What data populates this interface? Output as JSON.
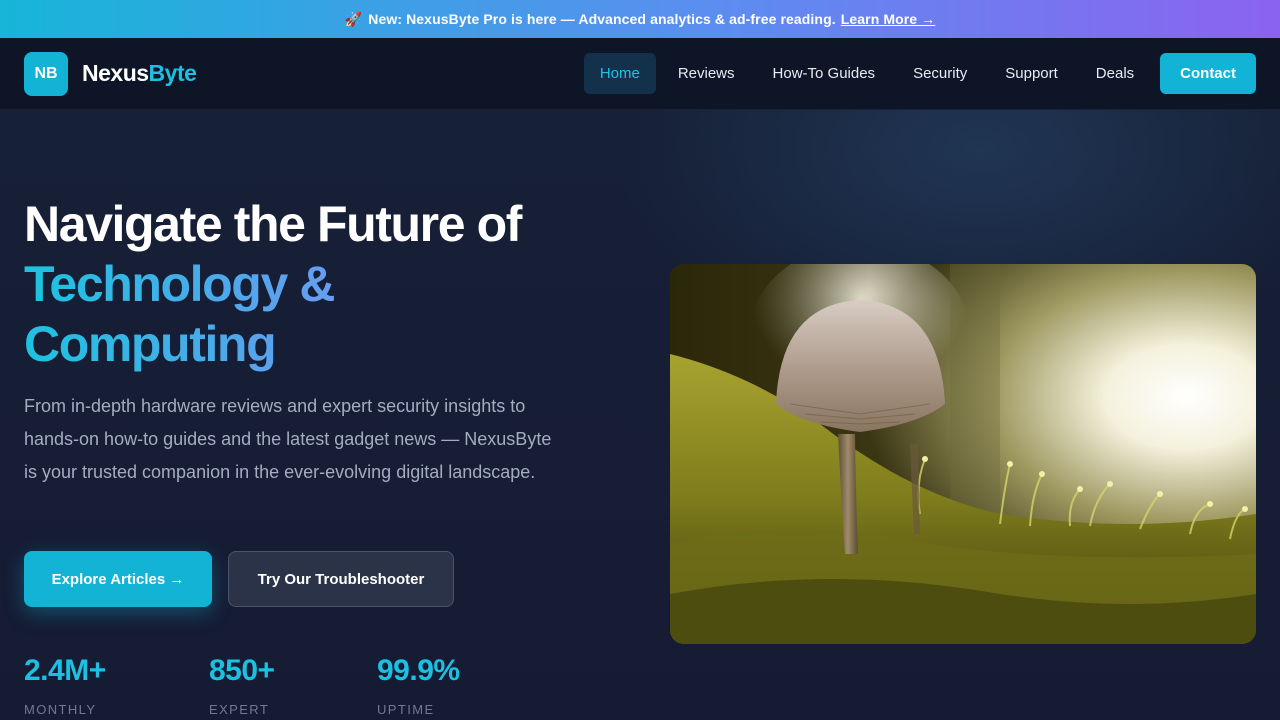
{
  "promo": {
    "icon": "rocket-icon",
    "text": "New: NexusByte Pro is here — Advanced analytics & ad-free reading.",
    "link": "Learn More →"
  },
  "brand": {
    "logo_initials": "NB",
    "name_part1": "Nexus",
    "name_part2": "Byte"
  },
  "nav": {
    "items": [
      "Home",
      "Reviews",
      "How-To Guides",
      "Security",
      "Support",
      "Deals"
    ],
    "active": "Home",
    "cta": "Contact"
  },
  "hero": {
    "headline_line1": "Navigate the Future of",
    "headline_line2": "Technology &",
    "headline_line3": "Computing",
    "lead": "From in-depth hardware reviews and expert security insights to hands-on how-to guides and the latest gadget news — NexusByte is your trusted companion in the ever-evolving digital landscape.",
    "primary_button": "Explore Articles →",
    "secondary_button": "Try Our Troubleshooter",
    "stats": [
      {
        "value": "2.4M+",
        "label": "MONTHLY READERS"
      },
      {
        "value": "850+",
        "label": "EXPERT REVIEWS"
      },
      {
        "value": "99.9%",
        "label": "UPTIME"
      }
    ],
    "image": "mushroom-in-moss-photo"
  },
  "colors": {
    "accent": "#12b3d4",
    "background": "#141c30",
    "nav_background": "#0e1526"
  }
}
